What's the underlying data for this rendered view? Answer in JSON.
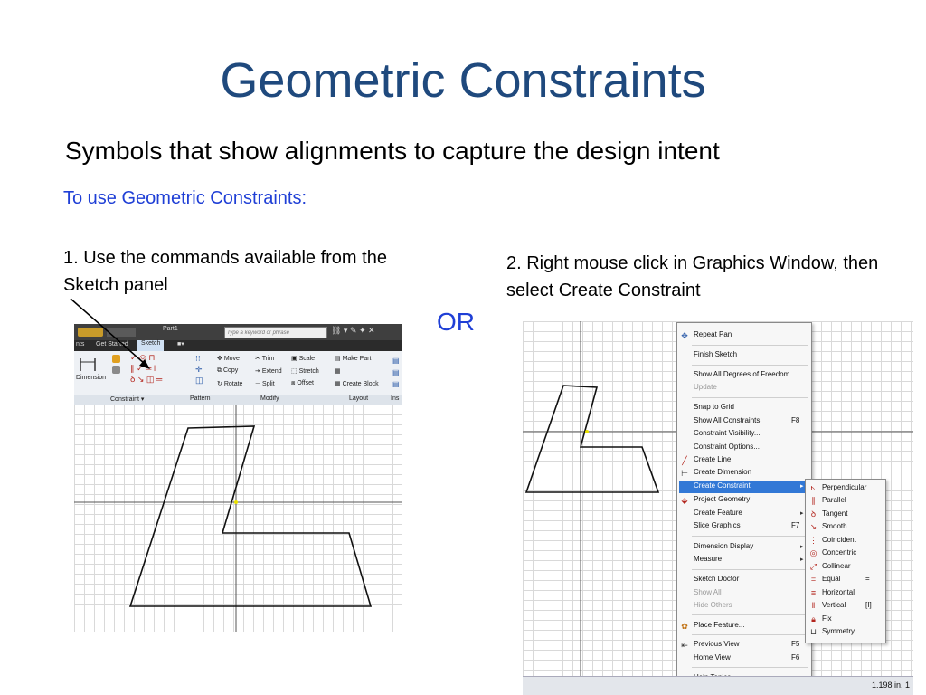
{
  "slide": {
    "title": "Geometric Constraints",
    "subtitle": "Symbols that show alignments to capture the design intent",
    "heading": "To use Geometric Constraints:",
    "step1": "1. Use the commands available from the Sketch panel",
    "step2": "2. Right mouse click in Graphics Window, then select Create Constraint",
    "or": "OR",
    "colors": {
      "title": "#1f497d",
      "accent": "#1f3fd6"
    }
  },
  "sketch_panel": {
    "window_title": "Part1",
    "search_placeholder": "Type a keyword or phrase",
    "tabs": [
      "nts",
      "Get Started",
      "Sketch"
    ],
    "dimension_label": "Dimension",
    "modify_tools": [
      "Move",
      "Trim",
      "Scale",
      "Copy",
      "Extend",
      "Stretch",
      "Rotate",
      "Split",
      "Offset"
    ],
    "layout_tools": [
      "Make Part",
      "Create Block"
    ],
    "panels": [
      "Constraint ▾",
      "Pattern",
      "Modify",
      "Layout",
      "Ins"
    ]
  },
  "context_menu": {
    "items": [
      {
        "label": "Repeat Pan",
        "icon": "pan-icon"
      },
      {
        "label": "Finish Sketch"
      },
      {
        "label": "Show All Degrees of Freedom"
      },
      {
        "label": "Update",
        "disabled": true
      },
      {
        "label": "Snap to Grid"
      },
      {
        "label": "Show All Constraints",
        "shortcut": "F8"
      },
      {
        "label": "Constraint Visibility..."
      },
      {
        "label": "Constraint Options..."
      },
      {
        "label": "Create Line",
        "icon": "line-icon"
      },
      {
        "label": "Create Dimension",
        "icon": "dimension-icon"
      },
      {
        "label": "Create Constraint",
        "highlighted": true,
        "submenu": true
      },
      {
        "label": "Project Geometry",
        "icon": "project-icon"
      },
      {
        "label": "Create Feature",
        "submenu": true
      },
      {
        "label": "Slice Graphics",
        "shortcut": "F7"
      },
      {
        "label": "Dimension Display",
        "submenu": true
      },
      {
        "label": "Measure",
        "submenu": true
      },
      {
        "label": "Sketch Doctor"
      },
      {
        "label": "Show All",
        "disabled": true
      },
      {
        "label": "Hide Others",
        "disabled": true
      },
      {
        "label": "Place Feature...",
        "icon": "place-feature-icon"
      },
      {
        "label": "Previous View",
        "shortcut": "F5",
        "icon": "previous-view-icon"
      },
      {
        "label": "Home View",
        "shortcut": "F6"
      },
      {
        "label": "Help Topics..."
      }
    ]
  },
  "constraint_submenu": {
    "items": [
      {
        "label": "Perpendicular",
        "icon": "perpendicular-icon"
      },
      {
        "label": "Parallel",
        "icon": "parallel-icon"
      },
      {
        "label": "Tangent",
        "icon": "tangent-icon"
      },
      {
        "label": "Smooth",
        "icon": "smooth-icon"
      },
      {
        "label": "Coincident",
        "icon": "coincident-icon"
      },
      {
        "label": "Concentric",
        "icon": "concentric-icon"
      },
      {
        "label": "Collinear",
        "icon": "collinear-icon"
      },
      {
        "label": "Equal",
        "shortcut": "=",
        "icon": "equal-icon"
      },
      {
        "label": "Horizontal",
        "icon": "horizontal-icon"
      },
      {
        "label": "Vertical",
        "shortcut": "[I]",
        "icon": "vertical-icon"
      },
      {
        "label": "Fix",
        "icon": "fix-icon"
      },
      {
        "label": "Symmetry",
        "icon": "symmetry-icon"
      }
    ]
  },
  "status_bar": {
    "text": "1.198 in, 1"
  }
}
